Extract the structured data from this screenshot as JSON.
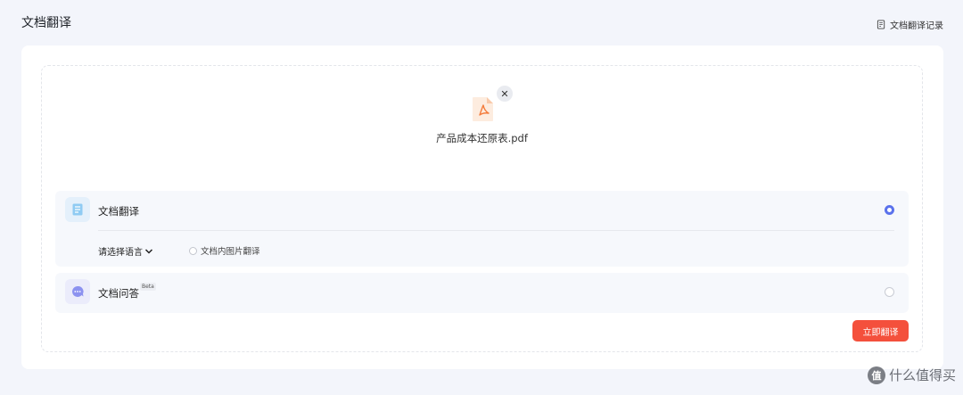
{
  "header": {
    "title": "文档翻译",
    "history_label": "文档翻译记录"
  },
  "file": {
    "name": "产品成本还原表.pdf",
    "remove_symbol": "✕"
  },
  "options": {
    "translate": {
      "title": "文档翻译",
      "selected": true,
      "language_select_label": "请选择语言",
      "image_translate_label": "文档内图片翻译"
    },
    "qa": {
      "title": "文档问答",
      "badge": "Beta",
      "selected": false
    }
  },
  "actions": {
    "start_label": "立即翻译"
  },
  "watermark": {
    "logo_text": "值",
    "text": "什么值得买"
  },
  "colors": {
    "accent": "#5b72ec",
    "primary_button": "#f4503c",
    "pdf_icon": "#f47c3c"
  }
}
